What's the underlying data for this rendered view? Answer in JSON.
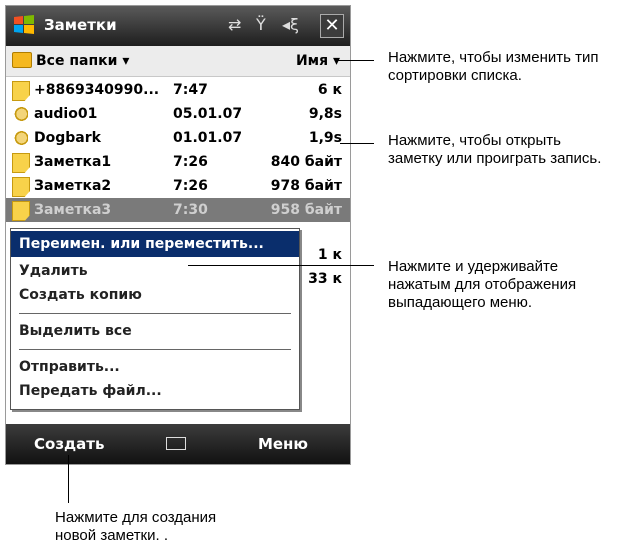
{
  "titlebar": {
    "title": "Заметки",
    "icons": [
      "sync-icon",
      "signal-icon",
      "volume-icon"
    ],
    "close_label": "✕"
  },
  "folderbar": {
    "folder_label": "Все папки ▾",
    "sort_label": "Имя ▾"
  },
  "list": [
    {
      "name": "+8869340990...",
      "date": "7:47",
      "size": "6 к",
      "icon": "note-icon"
    },
    {
      "name": "audio01",
      "date": "05.01.07",
      "size": "9,8s",
      "icon": "audio-icon"
    },
    {
      "name": "Dogbark",
      "date": "01.01.07",
      "size": "1,9s",
      "icon": "audio-icon"
    },
    {
      "name": "Заметка1",
      "date": "7:26",
      "size": "840 байт",
      "icon": "note-icon"
    },
    {
      "name": "Заметка2",
      "date": "7:26",
      "size": "978 байт",
      "icon": "note-icon"
    },
    {
      "name": "Заметка3",
      "date": "7:30",
      "size": "958 байт",
      "icon": "note-icon"
    }
  ],
  "hidden_sizes": [
    "1 к",
    "33 к"
  ],
  "context_menu": {
    "rename": "Переимен. или переместить...",
    "delete": "Удалить",
    "copy": "Создать копию",
    "select_all": "Выделить все",
    "send": "Отправить...",
    "beam": "Передать файл..."
  },
  "softkeys": {
    "left": "Создать",
    "right": "Меню"
  },
  "callouts": {
    "sort": "Нажмите, чтобы изменить тип сортировки списка.",
    "open": "Нажмите, чтобы открыть заметку или проиграть запись.",
    "hold": "Нажмите и удерживайте нажатым для отображения выпадающего меню.",
    "create": "Нажмите для создания новой заметки. ."
  },
  "colors": {
    "menu_highlight": "#0a2e6c",
    "selected_row": "#7a7a7a",
    "note_yellow": "#f8d24a"
  }
}
